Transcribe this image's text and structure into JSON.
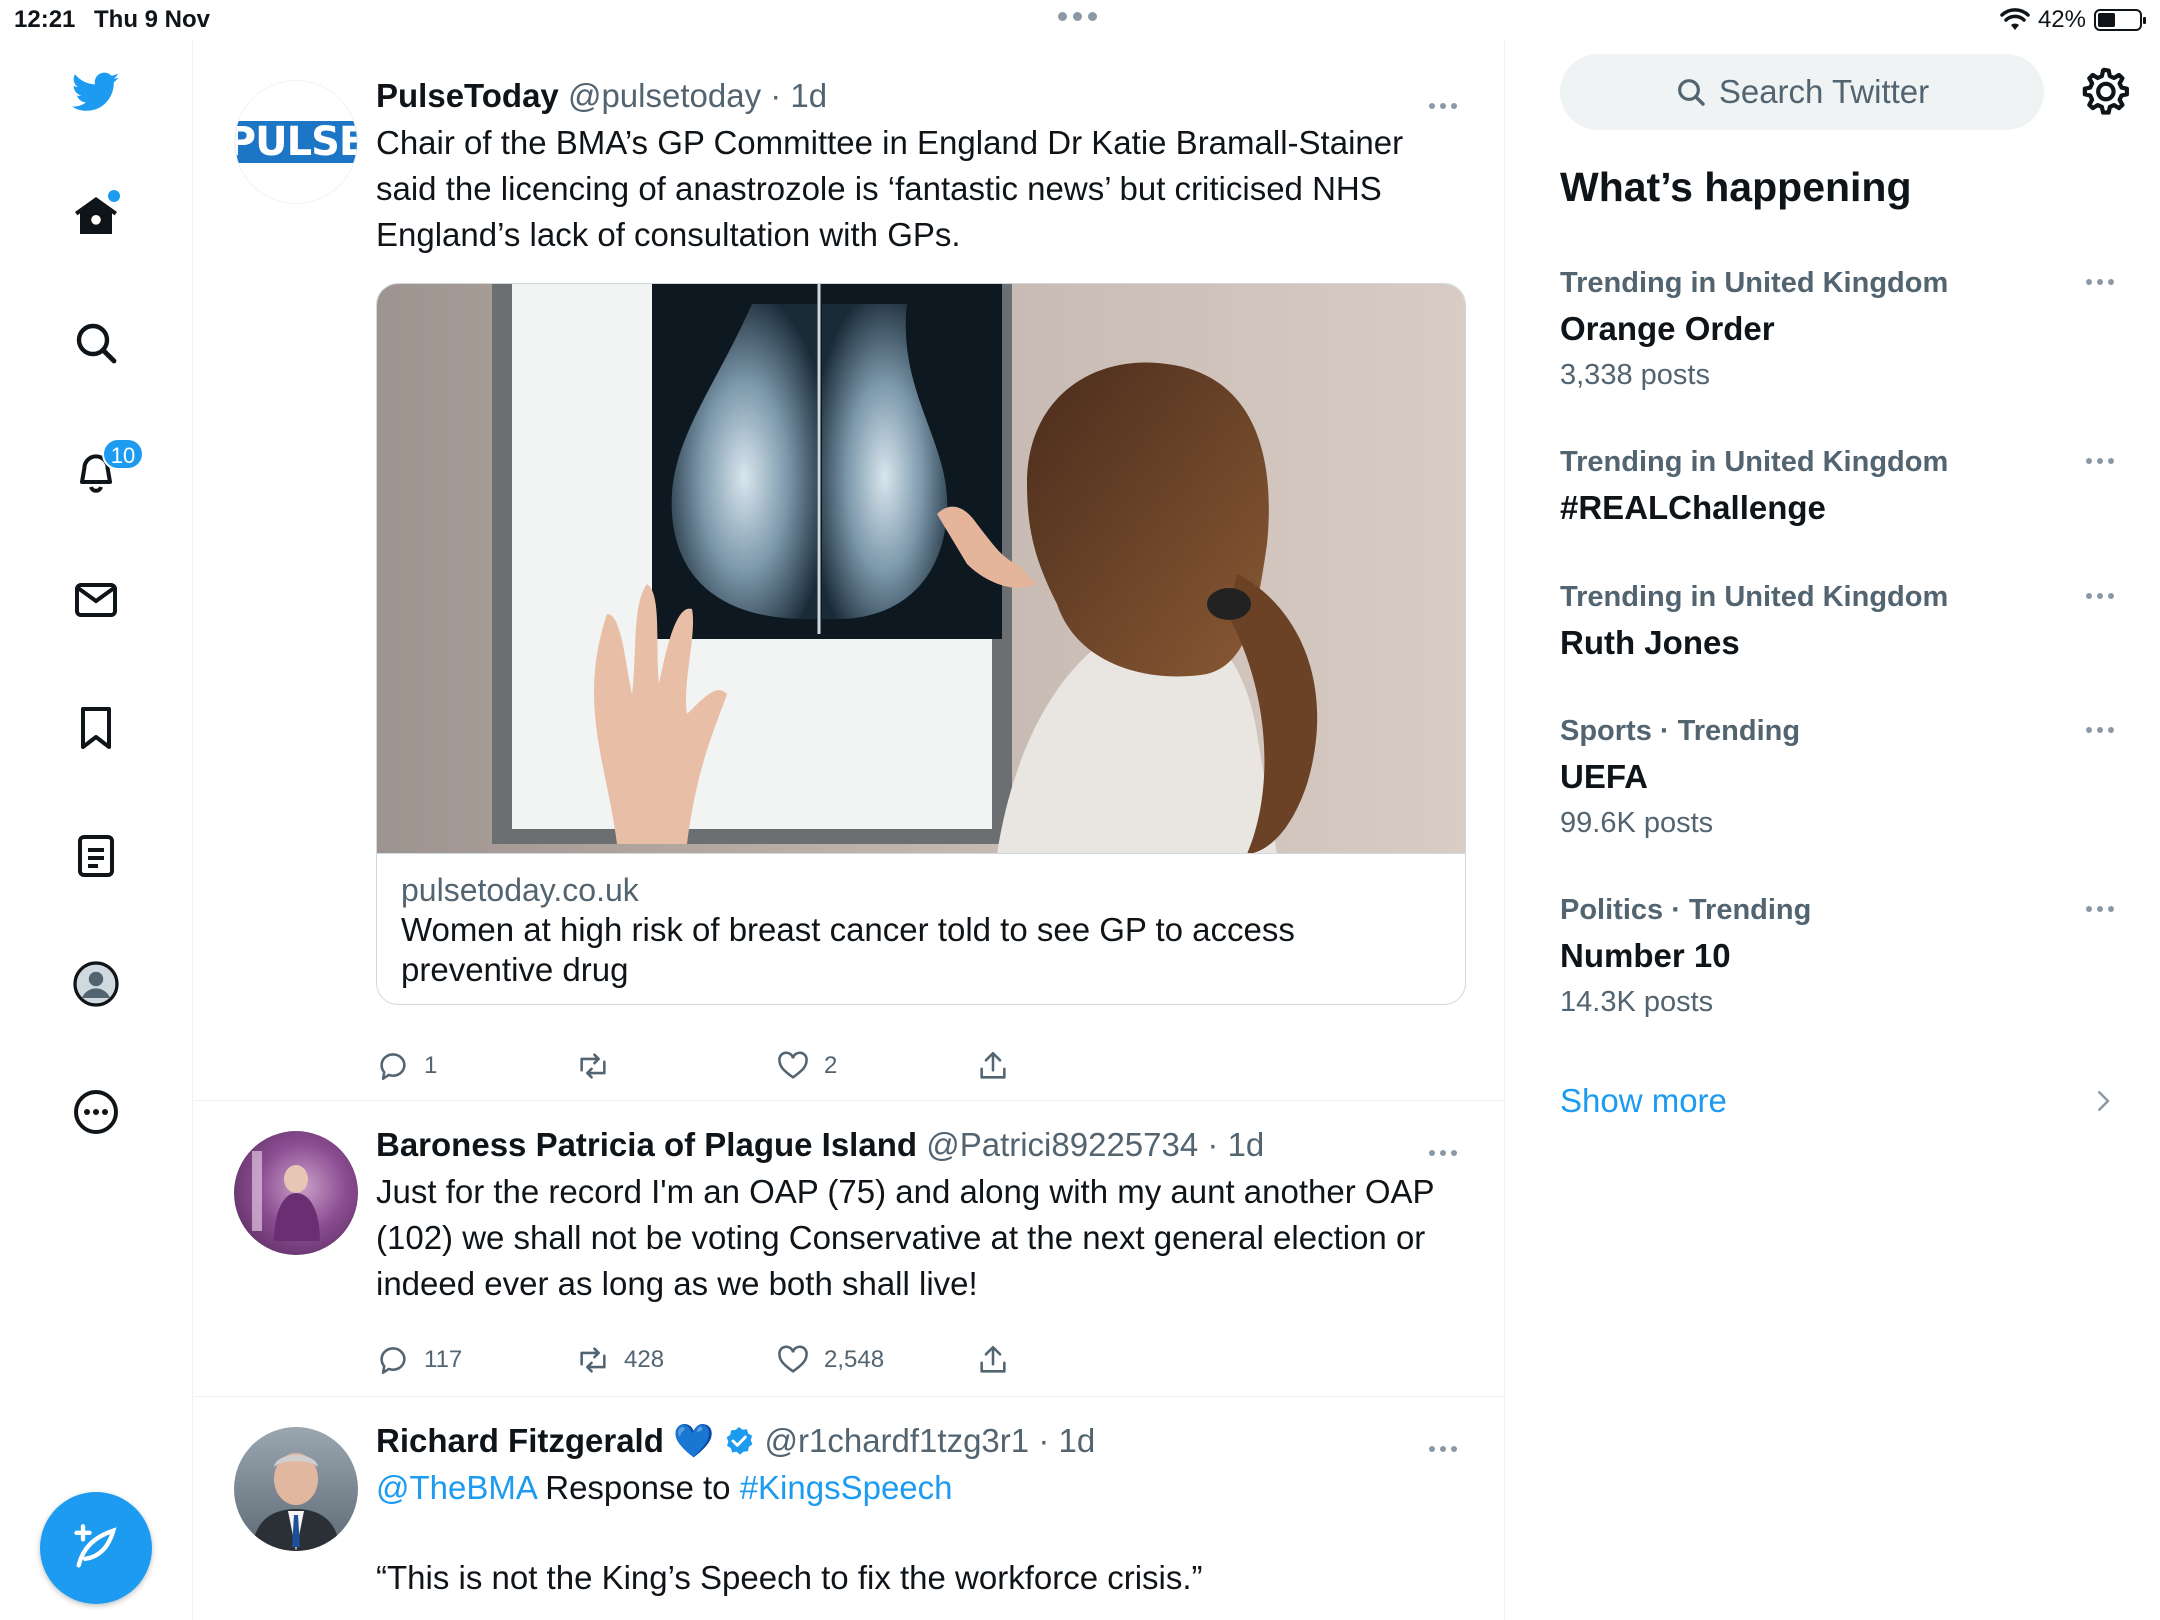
{
  "status_bar": {
    "time": "12:21",
    "date": "Thu 9 Nov",
    "battery_percent": "42%",
    "battery_level": 0.42
  },
  "nav": {
    "items": [
      {
        "name": "twitter-logo-icon"
      },
      {
        "name": "home-icon",
        "has_dot": true
      },
      {
        "name": "explore-icon"
      },
      {
        "name": "notifications-icon",
        "badge": "10"
      },
      {
        "name": "messages-icon"
      },
      {
        "name": "bookmarks-icon"
      },
      {
        "name": "lists-icon"
      },
      {
        "name": "profile-icon"
      },
      {
        "name": "more-icon"
      }
    ],
    "compose_icon": "compose-icon"
  },
  "timeline": {
    "tweets": [
      {
        "avatar_text": "PULSE",
        "name": "PulseToday",
        "handle": "@pulsetoday",
        "sep": "·",
        "time": "1d",
        "text": "Chair of the BMA’s GP Committee in England Dr Katie Bramall-Stainer said the licencing of anastrozole is ‘fantastic news’ but criticised NHS England’s lack of consultation with GPs.",
        "card": {
          "domain": "pulsetoday.co.uk",
          "title": "Women at high risk of breast cancer told to see GP to access preventive drug"
        },
        "replies": "1",
        "retweets": "",
        "likes": "2"
      },
      {
        "name": "Baroness Patricia of Plague Island",
        "handle": "@Patrici89225734",
        "sep": "·",
        "time": "1d",
        "text": "Just for the record I'm an OAP (75) and along with my aunt another OAP (102) we shall not be voting Conservative at the next general election or indeed ever as long as we both shall live!",
        "replies": "117",
        "retweets": "428",
        "likes": "2,548"
      },
      {
        "name": "Richard Fitzgerald",
        "emoji": "💙",
        "handle": "@r1chardf1tzg3r1",
        "sep": "·",
        "time": "1d",
        "mention": "@TheBMA",
        "text_mid": " Response to ",
        "hashtag": "#KingsSpeech",
        "quote": "“This is not the King’s Speech to fix the workforce crisis.”"
      }
    ]
  },
  "sidebar": {
    "search_placeholder": "Search Twitter",
    "heading": "What’s happening",
    "trends": [
      {
        "context": "Trending in United Kingdom",
        "name": "Orange Order",
        "count": "3,338 posts"
      },
      {
        "context": "Trending in United Kingdom",
        "name": "#REALChallenge",
        "count": ""
      },
      {
        "context": "Trending in United Kingdom",
        "name": "Ruth Jones",
        "count": ""
      },
      {
        "context": "Sports · Trending",
        "name": "UEFA",
        "count": "99.6K posts"
      },
      {
        "context": "Politics · Trending",
        "name": "Number 10",
        "count": "14.3K posts"
      }
    ],
    "show_more": "Show more"
  },
  "colors": {
    "accent": "#1d9bf0",
    "text": "#0f1419",
    "muted": "#536471"
  }
}
